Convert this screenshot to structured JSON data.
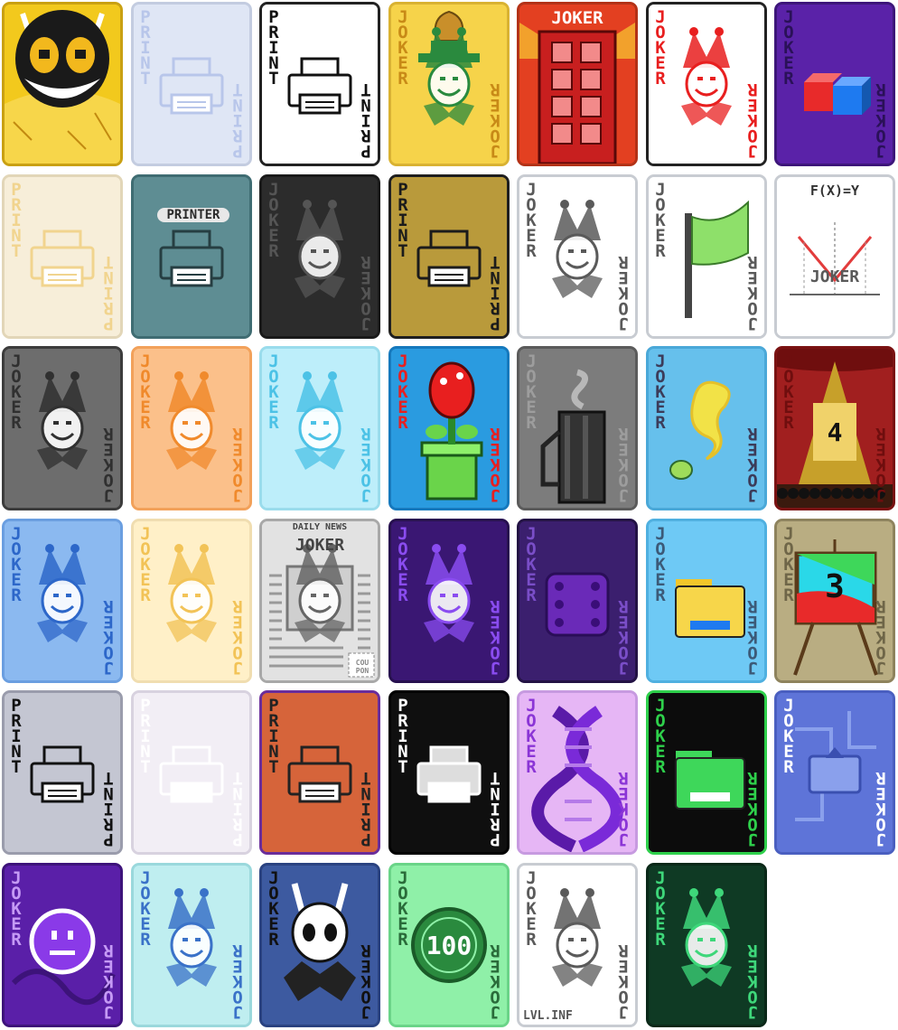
{
  "cards": [
    {
      "id": "cuphead-devil",
      "label": "",
      "icon": "devil-face-icon",
      "bg": "#f2c91d",
      "border": "#c9a012",
      "ink": "#222222"
    },
    {
      "id": "print-glass",
      "label": "PRINT",
      "icon": "printer-icon",
      "bg": "#dfe6f5",
      "border": "#c3cce0",
      "ink": "#b8c6ea"
    },
    {
      "id": "print-classic",
      "label": "PRINT",
      "icon": "printer-icon",
      "bg": "#ffffff",
      "border": "#222222",
      "ink": "#111111"
    },
    {
      "id": "joker-money",
      "label": "JOKER",
      "icon": "joker-money-bag-icon",
      "bg": "#f6d34a",
      "border": "#d9b232",
      "ink": "#c88a17"
    },
    {
      "id": "joker-building",
      "label": "JOKER",
      "icon": "building-icon",
      "bg": "#e34021",
      "border": "#b33217",
      "ink": "#ffffff"
    },
    {
      "id": "joker-red-line",
      "label": "JOKER",
      "icon": "joker-face-icon",
      "bg": "#ffffff",
      "border": "#222222",
      "ink": "#e81f1f"
    },
    {
      "id": "joker-cubes",
      "label": "JOKER",
      "icon": "cubes-icon",
      "bg": "#5a22a8",
      "border": "#3d167a",
      "ink": "#2a1158"
    },
    {
      "id": "print-cream",
      "label": "PRINT",
      "icon": "printer-icon",
      "bg": "#f7eed9",
      "border": "#e2d6b8",
      "ink": "#f1d48e"
    },
    {
      "id": "printer-device",
      "label": "PRINTER",
      "icon": "printer-icon",
      "bg": "#5e8d93",
      "border": "#3f6c72",
      "ink": "#263e42"
    },
    {
      "id": "joker-dark",
      "label": "JOKER",
      "icon": "joker-face-icon",
      "bg": "#2c2c2c",
      "border": "#1a1a1a",
      "ink": "#555555"
    },
    {
      "id": "print-gold",
      "label": "PRINT",
      "icon": "printer-icon",
      "bg": "#b99a3b",
      "border": "#1f1f1f",
      "ink": "#1b1b1b"
    },
    {
      "id": "joker-glasses",
      "label": "JOKER",
      "icon": "joker-face-icon",
      "bg": "#ffffff",
      "border": "#c8ccd2",
      "ink": "#5a5a5a"
    },
    {
      "id": "joker-flag",
      "label": "JOKER",
      "icon": "flag-icon",
      "bg": "#ffffff",
      "border": "#c8ccd2",
      "ink": "#5a5a5a"
    },
    {
      "id": "joker-fx",
      "label": "JOKER",
      "formula": "F(X)=Y",
      "icon": "graph-icon",
      "bg": "#ffffff",
      "border": "#c8ccd2",
      "ink": "#5a5a5a"
    },
    {
      "id": "joker-gray",
      "label": "JOKER",
      "icon": "joker-face-icon",
      "bg": "#6d6d6d",
      "border": "#3c3c3c",
      "ink": "#303030"
    },
    {
      "id": "joker-orange",
      "label": "JOKER",
      "icon": "joker-face-icon",
      "bg": "#fbc08a",
      "border": "#f2a15a",
      "ink": "#f08a2c"
    },
    {
      "id": "joker-cyan",
      "label": "JOKER",
      "icon": "joker-face-icon",
      "bg": "#bdeefa",
      "border": "#9adcec",
      "ink": "#4cc2e6"
    },
    {
      "id": "joker-piranha",
      "label": "JOKER",
      "icon": "piranha-plant-icon",
      "bg": "#2a9be0",
      "border": "#1679bd",
      "ink": "#e81f1f"
    },
    {
      "id": "joker-kettle",
      "label": "JOKER",
      "icon": "kettle-icon",
      "bg": "#7c7c7c",
      "border": "#5b5b5b",
      "ink": "#9d9d9d"
    },
    {
      "id": "joker-yellow-bird",
      "label": "JOKER",
      "icon": "bird-icon",
      "bg": "#66c0ec",
      "border": "#4aa8d8",
      "ink": "#3c3c5a"
    },
    {
      "id": "joker-stage-4",
      "label": "JOKER",
      "stage_number": "4",
      "icon": "stage-icon",
      "bg": "#a11f1f",
      "border": "#7a1212",
      "ink": "#6f0e0e"
    },
    {
      "id": "joker-blue-swirl",
      "label": "JOKER",
      "icon": "joker-face-icon",
      "bg": "#8bb9f0",
      "border": "#6a9ee0",
      "ink": "#2d67c9"
    },
    {
      "id": "joker-pale",
      "label": "JOKER",
      "icon": "joker-face-icon",
      "bg": "#fff0c8",
      "border": "#f0ddb0",
      "ink": "#f2c357"
    },
    {
      "id": "joker-news",
      "label": "JOKER",
      "headline": "DAILY NEWS",
      "coupon": "COU PON",
      "icon": "newspaper-icon",
      "bg": "#e2e2e2",
      "border": "#a8a8a8",
      "ink": "#555555"
    },
    {
      "id": "joker-purple-dark",
      "label": "JOKER",
      "icon": "joker-face-icon",
      "bg": "#3a1773",
      "border": "#27104f",
      "ink": "#8a4cf0"
    },
    {
      "id": "joker-dice",
      "label": "JOKER",
      "icon": "dice-icon",
      "bg": "#3b1f6e",
      "border": "#231244",
      "ink": "#7a4ec8"
    },
    {
      "id": "joker-folder",
      "label": "JOKER",
      "icon": "folder-icon",
      "bg": "#6ec9f5",
      "border": "#4fb0e0",
      "ink": "#3c5a78"
    },
    {
      "id": "joker-easel-3",
      "label": "JOKER",
      "easel_number": "3",
      "icon": "easel-icon",
      "bg": "#b9ad82",
      "border": "#8e835d",
      "ink": "#6f6648"
    },
    {
      "id": "print-holo",
      "label": "PRINT",
      "icon": "printer-icon",
      "bg": "#c4c6d2",
      "border": "#9a9cac",
      "ink": "#111111"
    },
    {
      "id": "print-prism",
      "label": "PRINT",
      "icon": "printer-icon",
      "bg": "#f2eef5",
      "border": "#d8d2df",
      "ink": "#ffffff"
    },
    {
      "id": "print-rainbow",
      "label": "PRINT",
      "icon": "printer-icon",
      "bg": "#d6643a",
      "border": "#6a2d9a",
      "ink": "#222222"
    },
    {
      "id": "print-black",
      "label": "PRINT",
      "icon": "printer-icon",
      "bg": "#0f0f0f",
      "border": "#000000",
      "ink": "#ffffff"
    },
    {
      "id": "joker-dna",
      "label": "JOKER",
      "icon": "dna-icon",
      "bg": "#e6b6f5",
      "border": "#c79ae0",
      "ink": "#8b35d6"
    },
    {
      "id": "joker-green-folder",
      "label": "JOKER",
      "icon": "folder-icon",
      "bg": "#0c0c0c",
      "border": "#2ed04b",
      "ink": "#2ed04b"
    },
    {
      "id": "joker-circuit",
      "label": "JOKER",
      "icon": "upload-icon",
      "bg": "#5e74d8",
      "border": "#4a5fc0",
      "ink": "#ffffff"
    },
    {
      "id": "joker-neutral-face",
      "label": "JOKER",
      "icon": "neutral-face-icon",
      "bg": "#5a1fa8",
      "border": "#3d137a",
      "ink": "#c59af5"
    },
    {
      "id": "joker-strong",
      "label": "JOKER",
      "icon": "joker-face-icon",
      "bg": "#bfeef0",
      "border": "#9ad8dc",
      "ink": "#3a72c8"
    },
    {
      "id": "joker-knight",
      "label": "JOKER",
      "icon": "hollow-knight-icon",
      "bg": "#3d5aa0",
      "border": "#2a4280",
      "ink": "#111111"
    },
    {
      "id": "joker-100",
      "label": "JOKER",
      "coin_value": "100",
      "icon": "coin-icon",
      "bg": "#8ff0a8",
      "border": "#6ad488",
      "ink": "#2a6b3a"
    },
    {
      "id": "joker-lvl-inf",
      "label": "JOKER",
      "level": "LVL.INF",
      "icon": "joker-face-icon",
      "bg": "#ffffff",
      "border": "#c8ccd2",
      "ink": "#5a5a5a"
    },
    {
      "id": "joker-green-ghost",
      "label": "JOKER",
      "icon": "joker-face-icon",
      "bg": "#0f3a24",
      "border": "#0a2818",
      "ink": "#3ed77a"
    }
  ]
}
